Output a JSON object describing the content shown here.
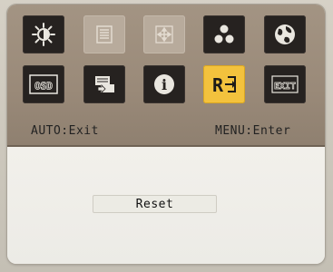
{
  "menu": {
    "icons": [
      {
        "name": "brightness-icon",
        "label": ""
      },
      {
        "name": "image-setup-icon",
        "label": ""
      },
      {
        "name": "position-icon",
        "label": ""
      },
      {
        "name": "color-setup-icon",
        "label": ""
      },
      {
        "name": "language-icon",
        "label": ""
      },
      {
        "name": "osd-setup-icon",
        "label": "OSD"
      },
      {
        "name": "input-select-icon",
        "label": ""
      },
      {
        "name": "information-icon",
        "label": "i"
      },
      {
        "name": "reset-icon",
        "label": "R"
      },
      {
        "name": "exit-icon",
        "label": "EXIT"
      }
    ],
    "selected": "reset-icon"
  },
  "hints": {
    "left": "AUTO:Exit",
    "right": "MENU:Enter"
  },
  "detail": {
    "label": "Reset"
  },
  "colors": {
    "top_panel": "#9a8a79",
    "tile_dark": "#262220",
    "tile_dim": "#b8ab9c",
    "tile_active": "#f3c23d",
    "bottom_panel": "#efede8"
  }
}
